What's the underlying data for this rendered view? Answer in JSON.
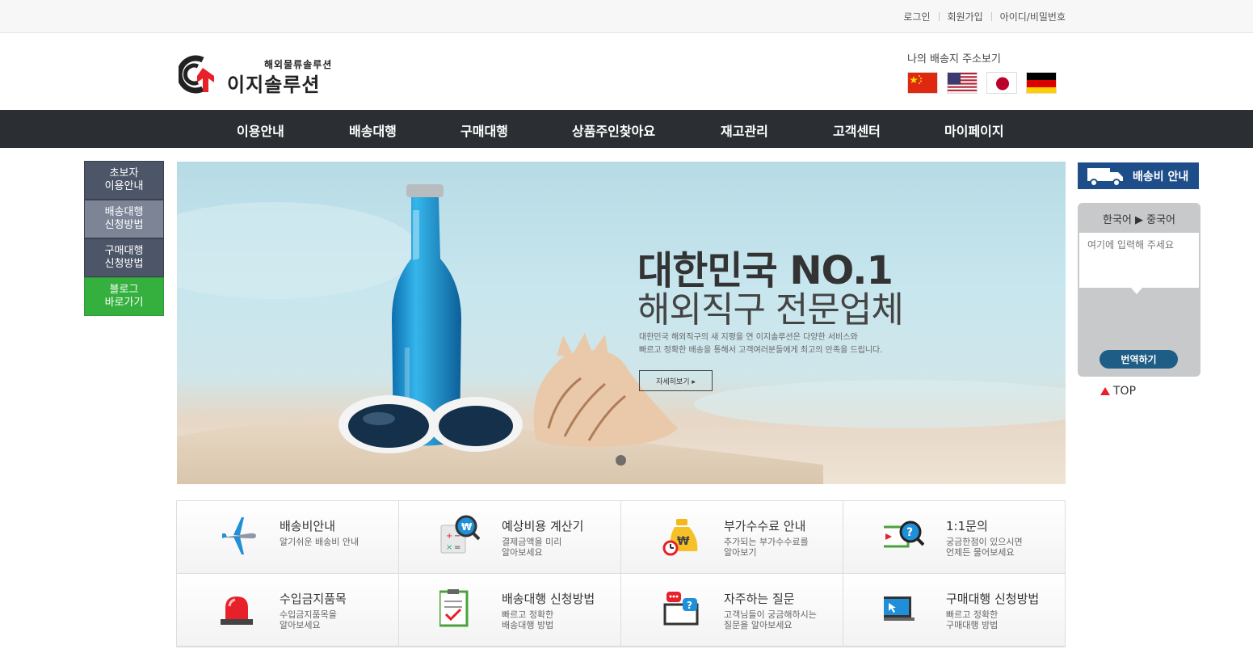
{
  "top_links": [
    "로그인",
    "회원가입",
    "아이디/비밀번호"
  ],
  "logo": {
    "sub": "해외물류솔루션",
    "name": "이지솔루션"
  },
  "address": {
    "title": "나의 배송지 주소보기",
    "flags": [
      "china-flag-icon",
      "usa-flag-icon",
      "japan-flag-icon",
      "germany-flag-icon"
    ]
  },
  "nav": [
    "이용안내",
    "배송대행",
    "구매대행",
    "상품주인찾아요",
    "재고관리",
    "고객센터",
    "마이페이지"
  ],
  "left_menu": [
    {
      "label": "초보자\n이용안내",
      "color": "#4d5668"
    },
    {
      "label": "배송대행\n신청방법",
      "color": "#7c8496"
    },
    {
      "label": "구매대행\n신청방법",
      "color": "#4d5668"
    },
    {
      "label": "블로그\n바로가기",
      "color": "#35b03e"
    }
  ],
  "banner": {
    "headline": "대한민국 NO.1",
    "subheadline": "해외직구 전문업체",
    "desc_line1": "대한민국 해외직구의 새 지평을 연 이지솔루션은 다양한 서비스와",
    "desc_line2": "빠르고 정확한 배송을 통해서 고객여러분들에게 최고의 만족을 드립니다.",
    "button": "자세히보기 ▸"
  },
  "side": {
    "shipping_guide": "배송비 안내",
    "translator_lang": "한국어 ▶ 중국어",
    "translator_placeholder": "여기에 입력해 주세요",
    "translate_button": "번역하기",
    "top": "TOP"
  },
  "services": [
    {
      "icon": "airplane-icon",
      "title": "배송비안내",
      "desc": "알기쉬운 배송비 안내"
    },
    {
      "icon": "calculator-icon",
      "title": "예상비용 계산기",
      "desc": "결제금액을 미리\n알아보세요"
    },
    {
      "icon": "money-bag-icon",
      "title": "부가수수료 안내",
      "desc": "추가되는 부가수수료를\n알아보기"
    },
    {
      "icon": "inquiry-icon",
      "title": "1:1문의",
      "desc": "궁금한점이 있으시면\n언제든 물어보세요"
    },
    {
      "icon": "siren-icon",
      "title": "수입금지품목",
      "desc": "수입금지품목을\n알아보세요"
    },
    {
      "icon": "checklist-icon",
      "title": "배송대행 신청방법",
      "desc": "빠르고 정확한\n배송대행 방법"
    },
    {
      "icon": "faq-chat-icon",
      "title": "자주하는 질문",
      "desc": "고객님들이 궁금해하시는\n질문을 알아보세요"
    },
    {
      "icon": "laptop-cursor-icon",
      "title": "구매대행 신청방법",
      "desc": "빠르고 정확한\n구매대행 방법"
    }
  ]
}
